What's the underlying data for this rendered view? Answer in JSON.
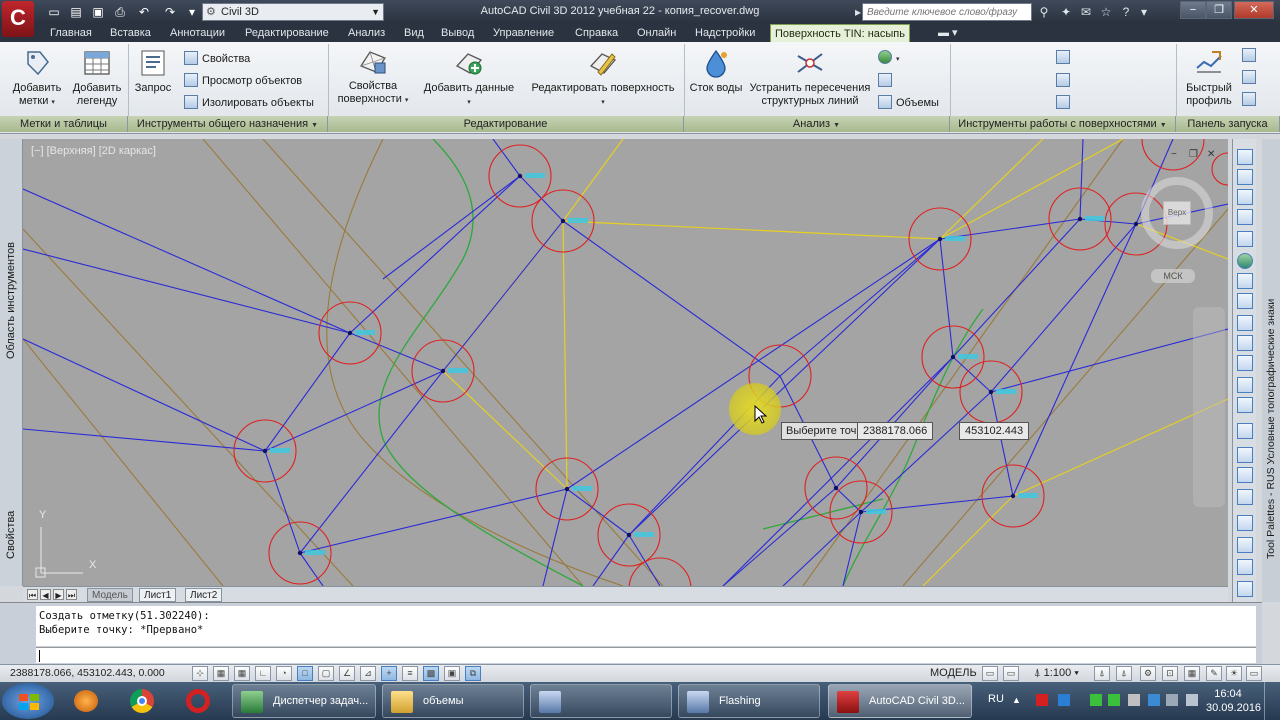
{
  "window": {
    "title": "AutoCAD Civil 3D 2012   учебная 22 - копия_recover.dwg",
    "workspace": "Civil 3D",
    "search_placeholder": "Введите ключевое слово/фразу",
    "logo_letter": "C"
  },
  "ribbon_tabs": [
    {
      "label": "Главная"
    },
    {
      "label": "Вставка"
    },
    {
      "label": "Аннотации"
    },
    {
      "label": "Редактирование"
    },
    {
      "label": "Анализ"
    },
    {
      "label": "Вид"
    },
    {
      "label": "Вывод"
    },
    {
      "label": "Управление"
    },
    {
      "label": "Справка"
    },
    {
      "label": "Онлайн"
    },
    {
      "label": "Надстройки"
    },
    {
      "label": "Поверхность TIN: насыпь"
    }
  ],
  "ribbon": {
    "add_labels": [
      "Добавить",
      "метки"
    ],
    "add_legend": [
      "Добавить",
      "легенду"
    ],
    "query": "Запрос",
    "properties": "Свойства",
    "view_objects": "Просмотр объектов",
    "isolate_objects": "Изолировать объекты",
    "surface_properties": [
      "Свойства",
      "поверхности"
    ],
    "add_data": "Добавить данные",
    "edit_surface": "Редактировать поверхность",
    "water_drop": "Сток воды",
    "resolve_crossings": [
      "Устранить пересечения",
      "структурных линий"
    ],
    "volumes": "Объемы",
    "quick_profile": [
      "Быстрый",
      "профиль"
    ],
    "panels": {
      "labels_tables": "Метки и таблицы",
      "general_tools": "Инструменты общего назначения",
      "modify": "Редактирование",
      "analyze": "Анализ",
      "surface_tools": "Инструменты работы с поверхностями",
      "launch_pad": "Панель запуска"
    }
  },
  "viewport": {
    "label": "[−] [Верхняя] [2D каркас]",
    "viewcube_face": "Верх",
    "ucs_button": "МСК",
    "prompt_label": "Выберите точку:",
    "coord_x": "2388178.066",
    "coord_y": "453102.443",
    "ucs_y": "Y",
    "ucs_x": "X"
  },
  "left_palette": {
    "tool_area": "Область инструментов",
    "properties": "Свойства"
  },
  "right_palette_title": "Tool Palettes - RUS Условные топографические знаки",
  "layout_tabs": [
    {
      "label": "Модель"
    },
    {
      "label": "Лист1"
    },
    {
      "label": "Лист2"
    }
  ],
  "command_line": {
    "line1": "Создать отметку(51.302240):",
    "line2": "Выберите точку: *Прервано*"
  },
  "status_bar": {
    "coords": "2388178.066, 453102.443, 0.000",
    "model": "МОДЕЛЬ",
    "scale": "1:100"
  },
  "taskbar": {
    "tasks": [
      {
        "label": "Диспетчер задач..."
      },
      {
        "label": "объемы"
      },
      {
        "label": ""
      },
      {
        "label": "Flashing"
      },
      {
        "label": "AutoCAD Civil 3D..."
      }
    ],
    "language": "RU",
    "time": "16:04",
    "date": "30.09.2016"
  }
}
